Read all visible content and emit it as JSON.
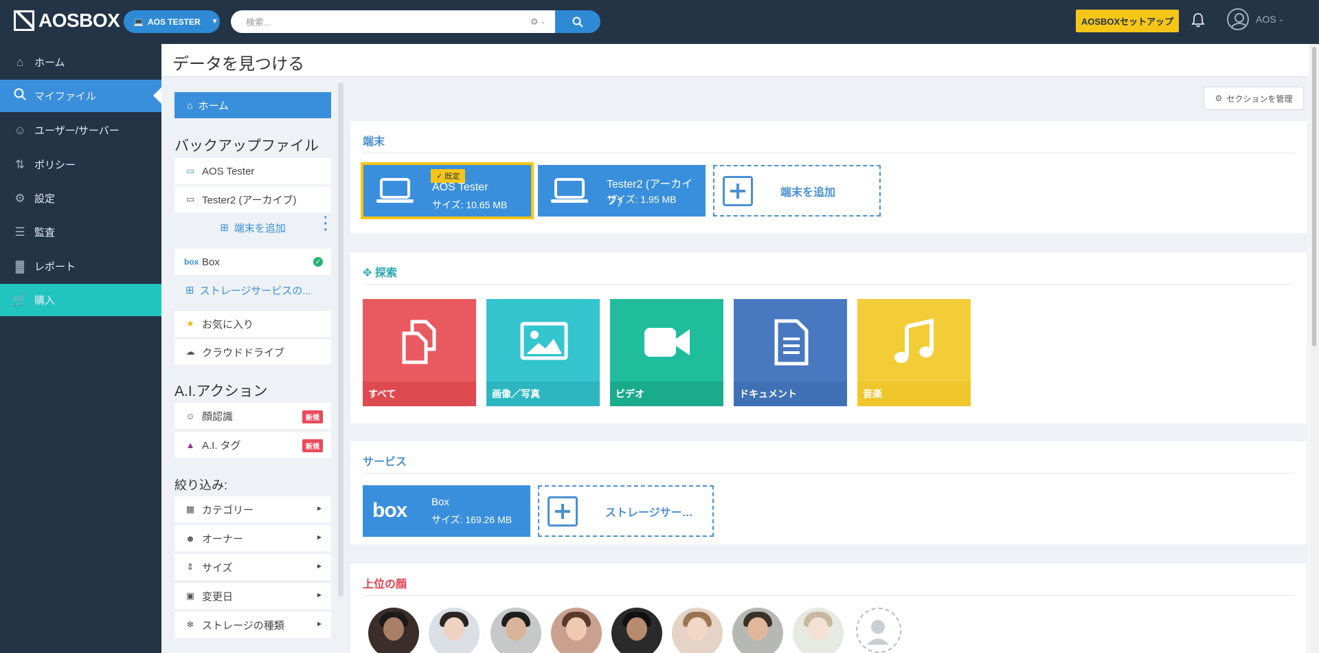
{
  "header": {
    "logo": "AOSBOX",
    "device_selector": "AOS TESTER",
    "search_placeholder": "検索...",
    "setup_button": "AOSBOXセットアップ",
    "user": "AOS"
  },
  "sidebar": {
    "items": [
      {
        "label": "ホーム",
        "icon": "home-icon"
      },
      {
        "label": "マイファイル",
        "icon": "search-icon"
      },
      {
        "label": "ユーザー/サーバー",
        "icon": "user-icon"
      },
      {
        "label": "ポリシー",
        "icon": "sliders-icon"
      },
      {
        "label": "設定",
        "icon": "gear-icon"
      },
      {
        "label": "監査",
        "icon": "list-icon"
      },
      {
        "label": "レポート",
        "icon": "bar-chart-icon"
      },
      {
        "label": "購入",
        "icon": "cart-icon"
      }
    ]
  },
  "page": {
    "title": "データを見つける"
  },
  "filters": {
    "home": "ホーム",
    "backup_header": "バックアップファイル",
    "devices": [
      "AOS Tester",
      "Tester2 (アーカイブ)"
    ],
    "add_device": "端末を追加",
    "storage": "Box",
    "add_storage": "ストレージサービスの...",
    "favorites": "お気に入り",
    "cloud_drive": "クラウドドライブ",
    "ai_header": "A.I.アクション",
    "face_recognition": "顔認識",
    "ai_tag": "A.I. タグ",
    "new_badge": "新規",
    "refine_header": "絞り込み:",
    "refine": [
      "カテゴリー",
      "オーナー",
      "サイズ",
      "変更日",
      "ストレージの種類"
    ]
  },
  "main": {
    "manage_sections": "セクションを管理",
    "devices_title": "端末",
    "default_tag": "既定",
    "devices": [
      {
        "name": "AOS Tester",
        "size": "サイズ: 10.65 MB"
      },
      {
        "name": "Tester2 (アーカイブ)",
        "size": "サイズ: 1.95 MB"
      }
    ],
    "add_device": "端末を追加",
    "explore_title": "探索",
    "tiles": [
      "すべて",
      "画像／写真",
      "ビデオ",
      "ドキュメント",
      "音楽"
    ],
    "services_title": "サービス",
    "services": [
      {
        "name": "Box",
        "size": "サイズ: 169.26 MB"
      }
    ],
    "add_service": "ストレージサービスを追加",
    "faces_title": "上位の顔"
  },
  "colors": {
    "topbar": "#243447",
    "accent": "#3a8fdc",
    "buy": "#22c4c0",
    "setup": "#f5c518",
    "tile_all": "#e85a5f",
    "tile_images": "#35c5cf",
    "tile_video": "#20bd9d",
    "tile_docs": "#4878c0",
    "tile_music": "#f3cd38"
  }
}
